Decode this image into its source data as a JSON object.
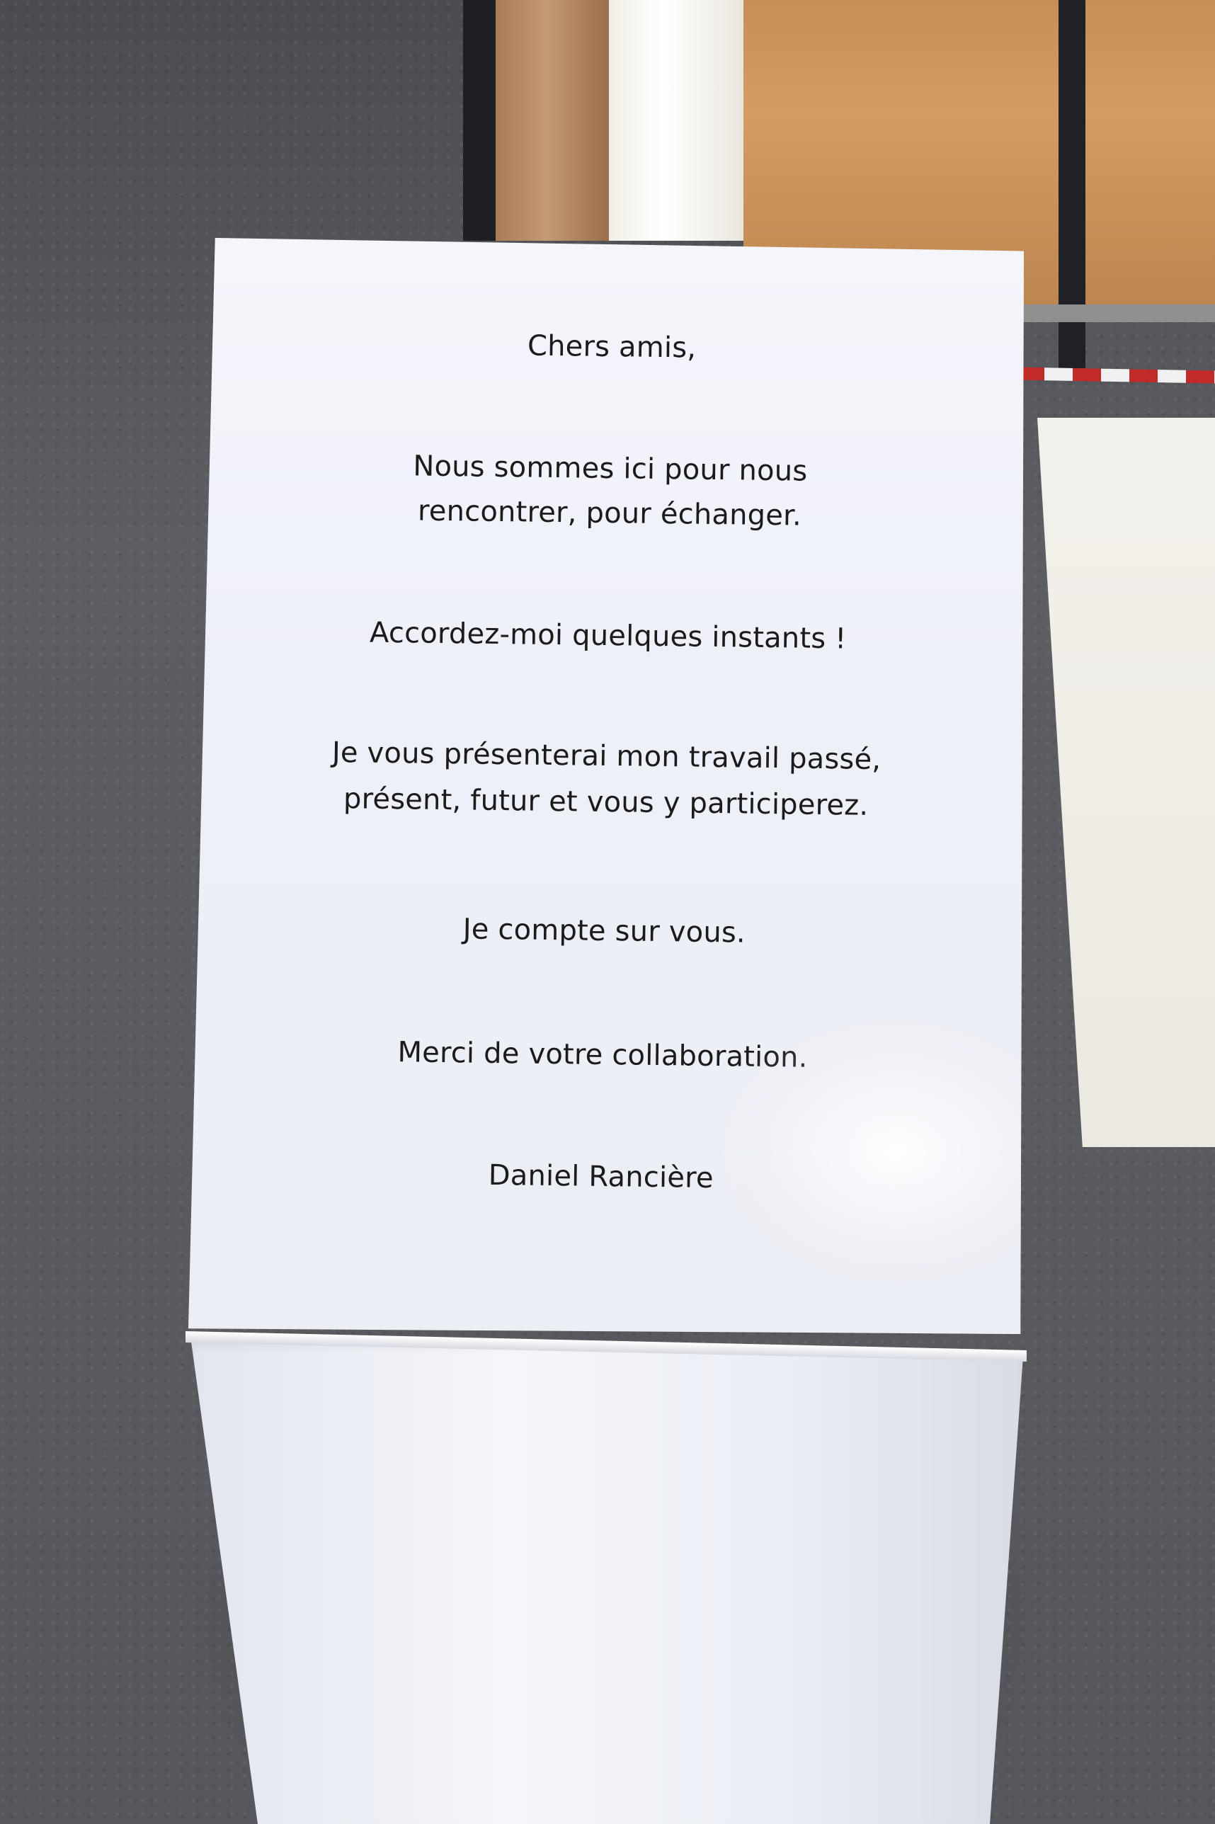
{
  "letter": {
    "lines": [
      "Chers amis,",
      "Nous sommes ici pour nous",
      "rencontrer, pour échanger.",
      "Accordez-moi quelques instants !",
      "Je vous présenterai mon travail passé,",
      "présent, futur et vous y participerez.",
      "Je compte sur vous.",
      "Merci de votre collaboration.",
      "Daniel Rancière"
    ]
  }
}
